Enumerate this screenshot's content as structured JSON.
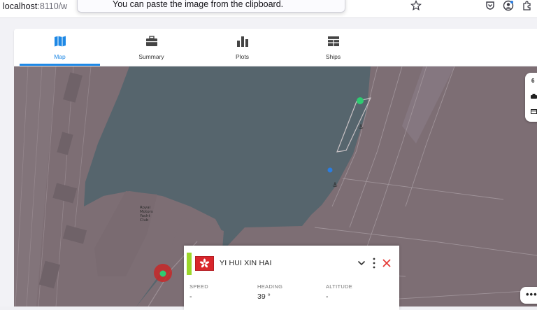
{
  "browser": {
    "url_host": "localhost",
    "url_path": ":8110/w",
    "popup_text": "You can paste the image from the clipboard.",
    "icons": [
      "lock-icon",
      "star-icon",
      "pocket-icon",
      "account-icon",
      "extensions-icon"
    ]
  },
  "tabs": [
    {
      "label": "Map",
      "icon": "map-icon",
      "active": true
    },
    {
      "label": "Summary",
      "icon": "briefcase-icon",
      "active": false
    },
    {
      "label": "Plots",
      "icon": "bar-chart-icon",
      "active": false
    },
    {
      "label": "Ships",
      "icon": "table-icon",
      "active": false
    }
  ],
  "map_controls": {
    "count": "6",
    "icons": [
      "ship-layer-icon",
      "card-icon"
    ],
    "more_label": "•••"
  },
  "ship_panel": {
    "name": "YI HUI XIN HAI",
    "flag": "hong-kong-flag-icon",
    "accent_color": "#9bd72a",
    "stats": [
      {
        "label": "SPEED",
        "value": "-"
      },
      {
        "label": "HEADING",
        "value": "39 °"
      },
      {
        "label": "ALTITUDE",
        "value": "-"
      }
    ]
  },
  "map_labels": {
    "yacht_club": [
      "Royal",
      "Motors",
      "Yacht",
      "Club"
    ]
  },
  "colors": {
    "accent_blue": "#1e88e5",
    "water": "#56656d",
    "land": "#7d6e74",
    "ship_green": "#2ecc71",
    "close_red": "#e53935"
  }
}
